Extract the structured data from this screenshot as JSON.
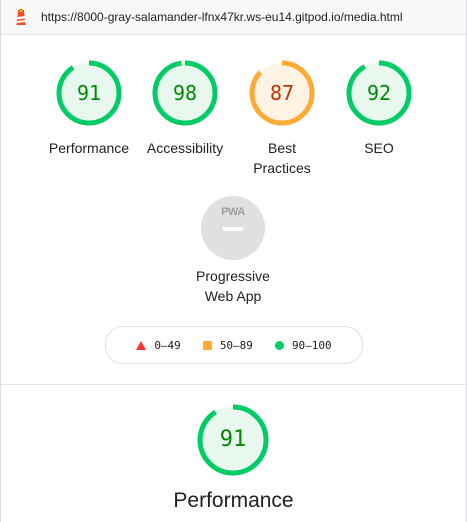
{
  "topbar": {
    "url": "https://8000-gray-salamander-lfnx47kr.ws-eu14.gitpod.io/media.html"
  },
  "colors": {
    "pass": "#0c6",
    "pass_text": "#008800",
    "average": "#fa3",
    "average_text": "#c33300",
    "fail": "#f33",
    "pass_bg": "#e8f8ef",
    "average_bg": "#fff4e4"
  },
  "gauges": [
    {
      "label": "Performance",
      "score": "91",
      "rating": "pass"
    },
    {
      "label": "Accessibility",
      "score": "98",
      "rating": "pass"
    },
    {
      "label": "Best Practices",
      "score": "87",
      "rating": "average"
    },
    {
      "label": "SEO",
      "score": "92",
      "rating": "pass"
    }
  ],
  "pwa": {
    "badge_text": "PWA",
    "label": "Progressive Web App"
  },
  "legend": {
    "fail": "0–49",
    "average": "50–89",
    "pass": "90–100"
  },
  "category": {
    "score": "91",
    "title": "Performance"
  }
}
